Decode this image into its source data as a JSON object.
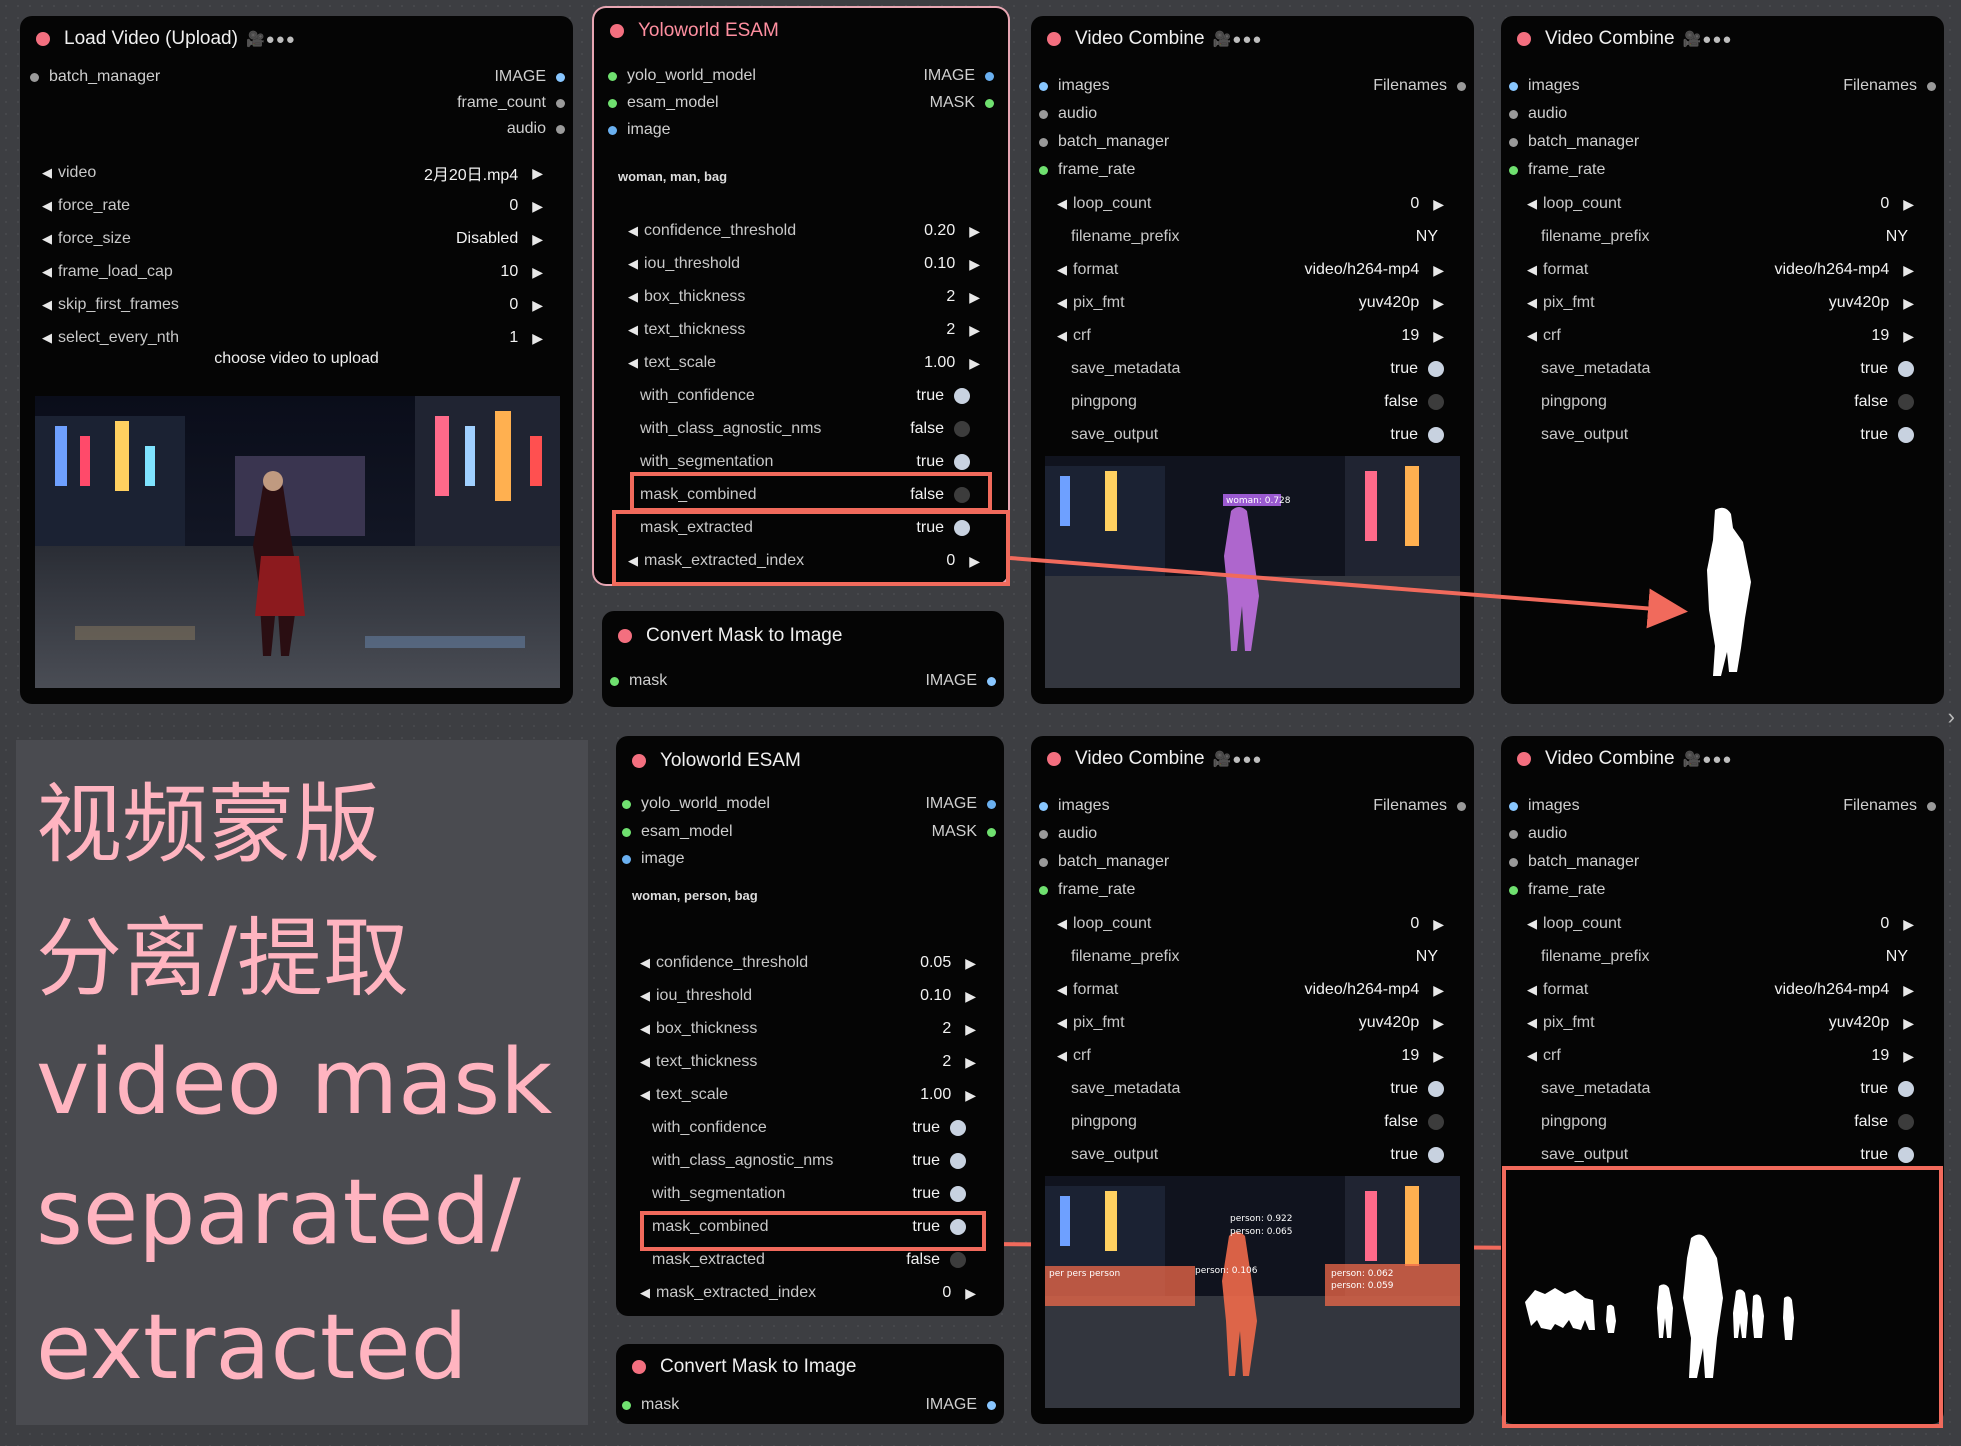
{
  "nodes": {
    "load_video": {
      "title": "Load Video (Upload)",
      "badge": "🎥●●●",
      "input": "batch_manager",
      "outputs": [
        "IMAGE",
        "frame_count",
        "audio"
      ],
      "widgets": [
        {
          "label": "video",
          "value": "2月20日.mp4"
        },
        {
          "label": "force_rate",
          "value": "0"
        },
        {
          "label": "force_size",
          "value": "Disabled"
        },
        {
          "label": "frame_load_cap",
          "value": "10"
        },
        {
          "label": "skip_first_frames",
          "value": "0"
        },
        {
          "label": "select_every_nth",
          "value": "1"
        }
      ],
      "upload_label": "choose video to upload"
    },
    "esam_top": {
      "title": "Yoloworld ESAM",
      "inputs": [
        "yolo_world_model",
        "esam_model",
        "image"
      ],
      "outputs": [
        "IMAGE",
        "MASK"
      ],
      "prompt": "woman, man, bag",
      "numeric": [
        {
          "label": "confidence_threshold",
          "value": "0.20"
        },
        {
          "label": "iou_threshold",
          "value": "0.10"
        },
        {
          "label": "box_thickness",
          "value": "2"
        },
        {
          "label": "text_thickness",
          "value": "2"
        },
        {
          "label": "text_scale",
          "value": "1.00"
        }
      ],
      "toggles": [
        {
          "label": "with_confidence",
          "value": "true"
        },
        {
          "label": "with_class_agnostic_nms",
          "value": "false"
        },
        {
          "label": "with_segmentation",
          "value": "true"
        },
        {
          "label": "mask_combined",
          "value": "false"
        },
        {
          "label": "mask_extracted",
          "value": "true"
        }
      ],
      "last": {
        "label": "mask_extracted_index",
        "value": "0"
      }
    },
    "esam_bottom": {
      "title": "Yoloworld ESAM",
      "inputs": [
        "yolo_world_model",
        "esam_model",
        "image"
      ],
      "outputs": [
        "IMAGE",
        "MASK"
      ],
      "prompt": "woman, person, bag",
      "numeric": [
        {
          "label": "confidence_threshold",
          "value": "0.05"
        },
        {
          "label": "iou_threshold",
          "value": "0.10"
        },
        {
          "label": "box_thickness",
          "value": "2"
        },
        {
          "label": "text_thickness",
          "value": "2"
        },
        {
          "label": "text_scale",
          "value": "1.00"
        }
      ],
      "toggles": [
        {
          "label": "with_confidence",
          "value": "true"
        },
        {
          "label": "with_class_agnostic_nms",
          "value": "true"
        },
        {
          "label": "with_segmentation",
          "value": "true"
        },
        {
          "label": "mask_combined",
          "value": "true"
        },
        {
          "label": "mask_extracted",
          "value": "false"
        }
      ],
      "last": {
        "label": "mask_extracted_index",
        "value": "0"
      }
    },
    "convert_top": {
      "title": "Convert Mask to Image",
      "input": "mask",
      "output": "IMAGE"
    },
    "convert_bottom": {
      "title": "Convert Mask to Image",
      "input": "mask",
      "output": "IMAGE"
    },
    "video_combine": {
      "title": "Video Combine",
      "badge": "🎥●●●",
      "inputs": [
        "images",
        "audio",
        "batch_manager",
        "frame_rate"
      ],
      "output": "Filenames",
      "widgets": [
        {
          "label": "loop_count",
          "value": "0",
          "kind": "arrow"
        },
        {
          "label": "filename_prefix",
          "value": "NY",
          "kind": "text"
        },
        {
          "label": "format",
          "value": "video/h264-mp4",
          "kind": "arrow"
        },
        {
          "label": "pix_fmt",
          "value": "yuv420p",
          "kind": "arrow"
        },
        {
          "label": "crf",
          "value": "19",
          "kind": "arrow"
        },
        {
          "label": "save_metadata",
          "value": "true",
          "kind": "toggle"
        },
        {
          "label": "pingpong",
          "value": "false",
          "kind": "toggle"
        },
        {
          "label": "save_output",
          "value": "true",
          "kind": "toggle"
        }
      ]
    }
  },
  "detections_top": [
    "woman: 0.728"
  ],
  "detections_bottom": [
    "person: 0.922",
    "person: 0.065",
    "per pers person",
    "person: 0.106",
    "person: 0.062",
    "person: 0.059"
  ],
  "overlay": {
    "lines": [
      "视频蒙版",
      "分离/提取",
      "video mask",
      "separated/",
      "extracted"
    ]
  },
  "colors": {
    "node_bg": "#050505",
    "title_dot": "#f36f7f",
    "highlight": "#f16a5c",
    "overlay_text": "#ffb4c0"
  }
}
